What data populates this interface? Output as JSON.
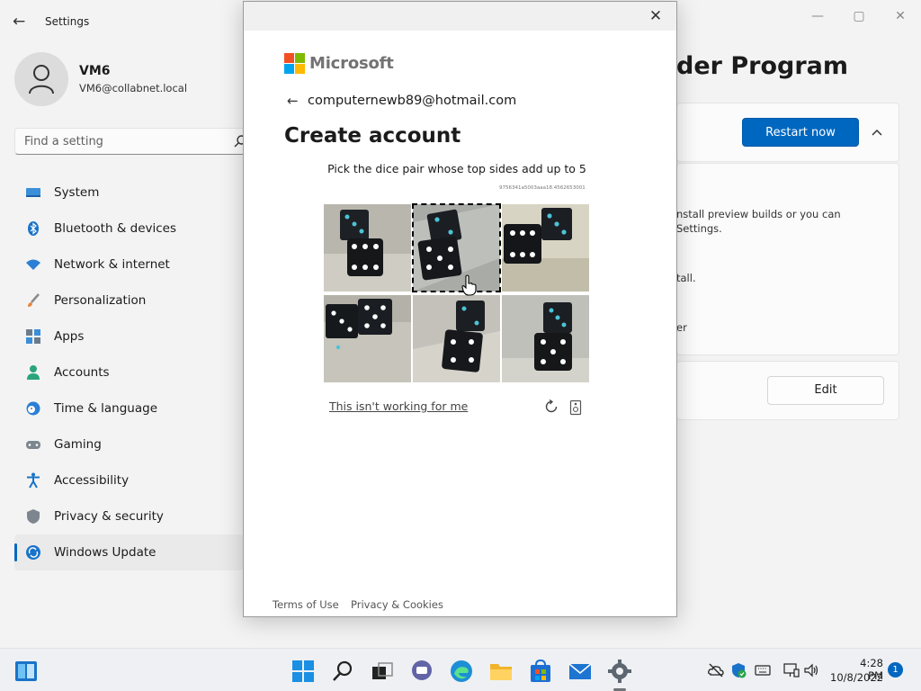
{
  "app": {
    "title": "Settings"
  },
  "window_controls": {
    "minimize": "—",
    "maximize": "▢",
    "close": "✕"
  },
  "profile": {
    "name": "VM6",
    "email": "VM6@collabnet.local"
  },
  "search": {
    "placeholder": "Find a setting"
  },
  "sidebar": {
    "items": [
      {
        "label": "System",
        "icon": "system-icon"
      },
      {
        "label": "Bluetooth & devices",
        "icon": "bluetooth-icon"
      },
      {
        "label": "Network & internet",
        "icon": "wifi-icon"
      },
      {
        "label": "Personalization",
        "icon": "brush-icon"
      },
      {
        "label": "Apps",
        "icon": "apps-icon"
      },
      {
        "label": "Accounts",
        "icon": "accounts-icon"
      },
      {
        "label": "Time & language",
        "icon": "clock-globe-icon"
      },
      {
        "label": "Gaming",
        "icon": "gamepad-icon"
      },
      {
        "label": "Accessibility",
        "icon": "accessibility-icon"
      },
      {
        "label": "Privacy & security",
        "icon": "shield-icon"
      },
      {
        "label": "Windows Update",
        "icon": "update-icon",
        "active": true
      }
    ]
  },
  "main": {
    "heading": "der Program",
    "restart_label": "Restart now",
    "text_1": "nstall preview builds or you can",
    "text_2": "Settings.",
    "text_3": "tall.",
    "text_4": "er",
    "edit_label": "Edit"
  },
  "dialog": {
    "close": "✕",
    "brand": "Microsoft",
    "back": "←",
    "identity": "computernewb89@hotmail.com",
    "title": "Create account",
    "instruction": "Pick the dice pair whose top sides add up to 5",
    "challenge_id": "9756341a5003aaa18.4562653001",
    "not_working": "This isn't working for me",
    "footer_terms": "Terms of Use",
    "footer_privacy": "Privacy & Cookies",
    "selected_tile": 1
  },
  "taskbar": {
    "time": "4:28 PM",
    "date": "10/8/2022",
    "notifications": "1"
  },
  "colors": {
    "accent": "#0067c0",
    "ms_red": "#f25022",
    "ms_green": "#7fba00",
    "ms_blue": "#00a4ef",
    "ms_yellow": "#ffb900"
  }
}
